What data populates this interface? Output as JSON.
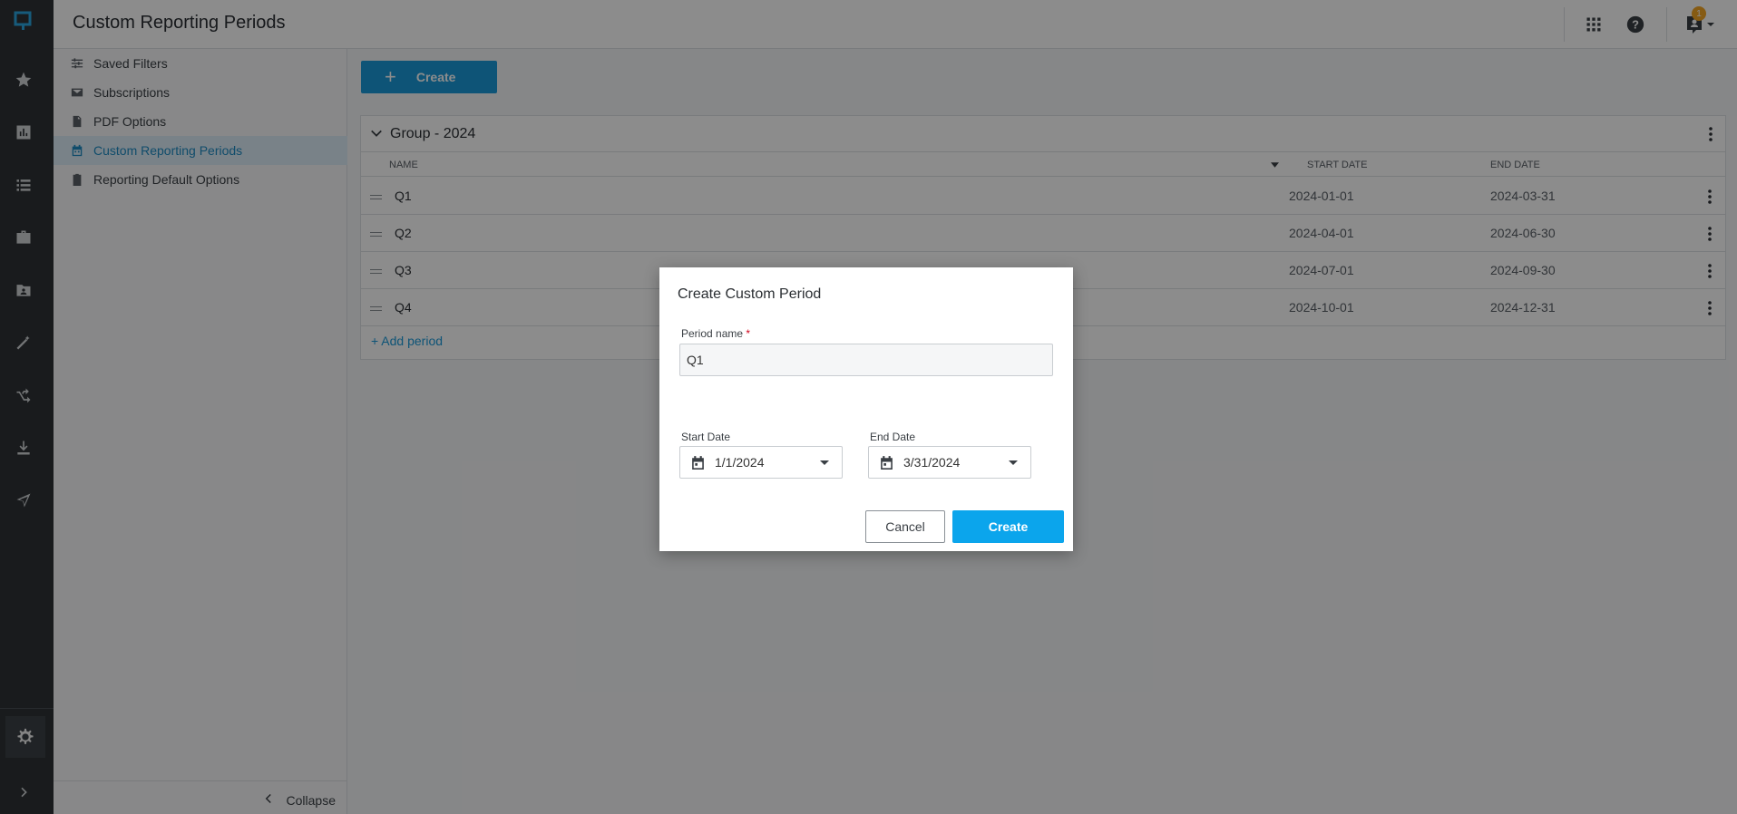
{
  "header": {
    "title": "Custom Reporting Periods",
    "notification_count": "1"
  },
  "sidebar": {
    "items": [
      {
        "label": "Saved Filters",
        "icon": "sliders-icon"
      },
      {
        "label": "Subscriptions",
        "icon": "mail-icon"
      },
      {
        "label": "PDF Options",
        "icon": "pdf-icon"
      },
      {
        "label": "Custom Reporting Periods",
        "icon": "calendar-icon",
        "active": true
      },
      {
        "label": "Reporting Default Options",
        "icon": "clipboard-icon"
      }
    ],
    "collapse_label": "Collapse"
  },
  "toolbar": {
    "create_label": "Create"
  },
  "group": {
    "title": "Group - 2024",
    "columns": {
      "name": "NAME",
      "start": "START DATE",
      "end": "END DATE"
    },
    "rows": [
      {
        "name": "Q1",
        "start": "2024-01-01",
        "end": "2024-03-31"
      },
      {
        "name": "Q2",
        "start": "2024-04-01",
        "end": "2024-06-30"
      },
      {
        "name": "Q3",
        "start": "2024-07-01",
        "end": "2024-09-30"
      },
      {
        "name": "Q4",
        "start": "2024-10-01",
        "end": "2024-12-31"
      }
    ],
    "add_period_label": "+ Add period"
  },
  "dialog": {
    "title": "Create Custom Period",
    "period_name_label": "Period name",
    "required_mark": "*",
    "period_name_value": "Q1",
    "start_date_label": "Start Date",
    "start_date_value": "1/1/2024",
    "end_date_label": "End Date",
    "end_date_value": "3/31/2024",
    "cancel_label": "Cancel",
    "create_label": "Create"
  },
  "colors": {
    "accent": "#1a9ad9",
    "primary_button": "#0ba5ec",
    "rail": "#2e3236",
    "badge": "#f5a623"
  }
}
